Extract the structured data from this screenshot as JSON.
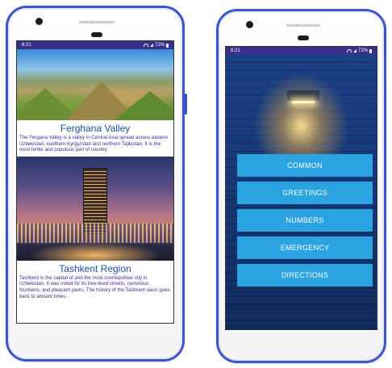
{
  "status_bar": {
    "time": "6:21",
    "battery": "72%"
  },
  "places": [
    {
      "title": "Ferghana Valley",
      "description": "The Fergana Valley is a valley in Central Asia spread across eastern Uzbekistan, southern Kyrgyzstan and northern Tajikistan. It is the most fertile and populous part of country."
    },
    {
      "title": "Tashkent Region",
      "description": "Tashkent is the capital of and the most cosmopolitan city in Uzbekistan. It was noted for its tree-lined streets, numerous fountains, and pleasant parks. The history of the Tashkent oasis goes back to ancient times."
    }
  ],
  "menu": {
    "items": [
      "COMMON",
      "GREETINGS",
      "NUMBERS",
      "EMERGENCY",
      "DIRECTIONS"
    ]
  },
  "colors": {
    "device_frame": "#3c55c8",
    "status_bar": "#3a2f8a",
    "title_text": "#1f4fa3",
    "body_text": "#3b2a9a",
    "menu_button": "#2aa3e0",
    "wall": "#1b3f86"
  }
}
